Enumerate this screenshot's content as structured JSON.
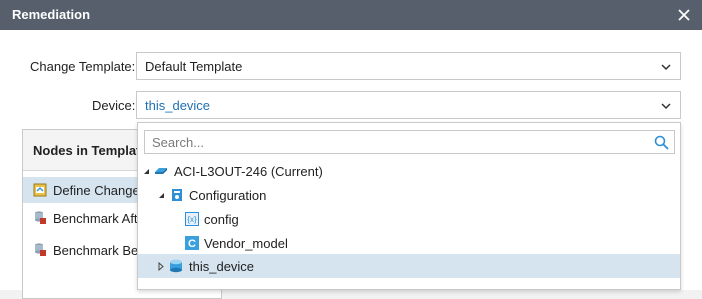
{
  "window": {
    "title": "Remediation"
  },
  "form": {
    "change_template": {
      "label": "Change Template:",
      "value": "Default Template"
    },
    "device": {
      "label": "Device:",
      "value": "this_device"
    }
  },
  "left_panel": {
    "header": "Nodes in Template",
    "items": [
      {
        "label": "Define Change",
        "icon": "define-change-icon"
      },
      {
        "label": "Benchmark Aft",
        "icon": "benchmark-icon"
      },
      {
        "label": "Benchmark Bef",
        "icon": "benchmark-icon"
      }
    ]
  },
  "dropdown": {
    "search_placeholder": "Search...",
    "tree": [
      {
        "label": "ACI-L3OUT-246 (Current)",
        "icon": "device-icon",
        "expanded": true
      },
      {
        "label": "Configuration",
        "icon": "configuration-icon",
        "expanded": true
      },
      {
        "label": "config",
        "icon": "variable-icon"
      },
      {
        "label": "Vendor_model",
        "icon": "c-icon"
      },
      {
        "label": "this_device",
        "icon": "database-icon",
        "expanded": false,
        "selected": true
      }
    ]
  },
  "colors": {
    "titlebar": "#565f6b",
    "selection": "#d6e4ef",
    "link": "#1f6fb2",
    "accent": "#2f8fd6"
  }
}
